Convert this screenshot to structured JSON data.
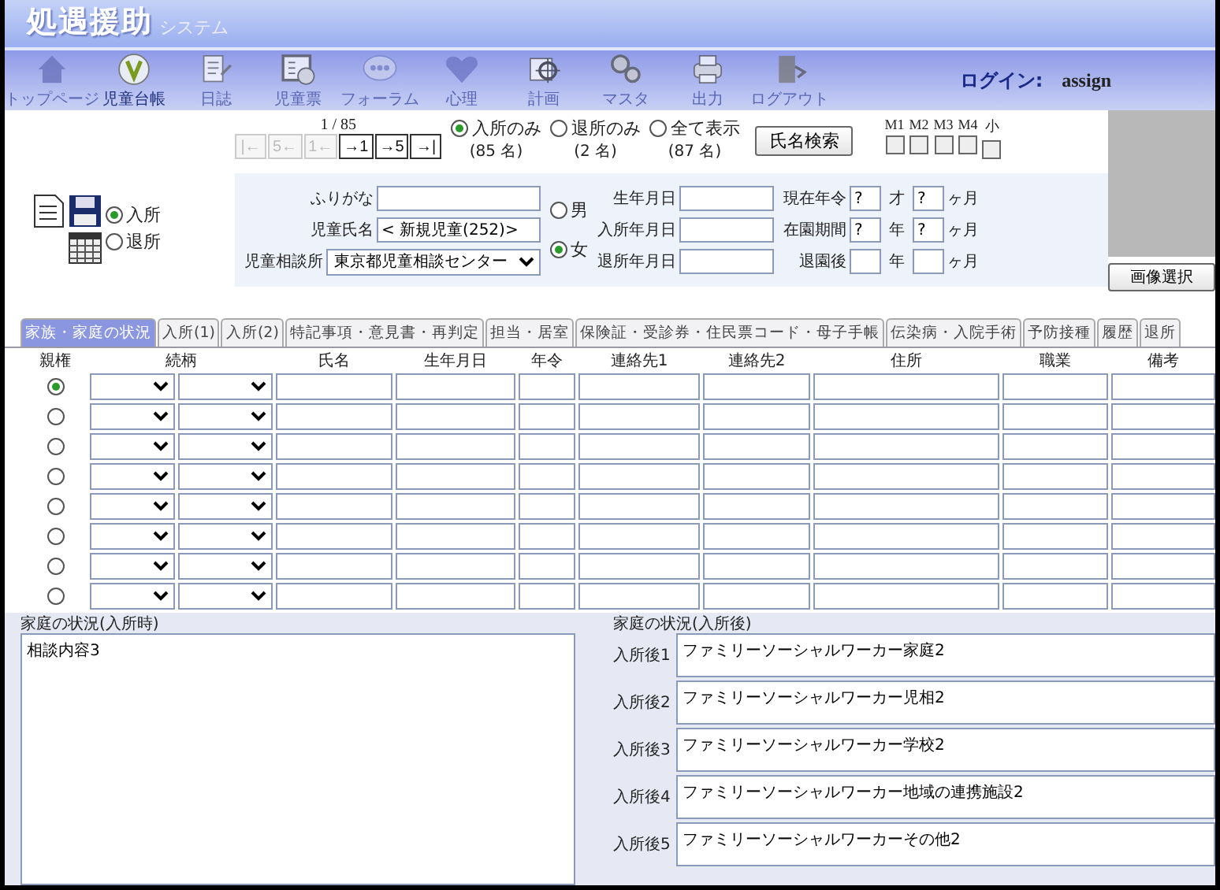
{
  "app": {
    "title": "処遇援助",
    "subtitle": "システム"
  },
  "toolbar": [
    {
      "label": "トップページ",
      "disabled": true
    },
    {
      "label": "児童台帳",
      "disabled": false
    },
    {
      "label": "日誌",
      "disabled": true
    },
    {
      "label": "児童票",
      "disabled": true
    },
    {
      "label": "フォーラム",
      "disabled": true
    },
    {
      "label": "心理",
      "disabled": true
    },
    {
      "label": "計画",
      "disabled": true
    },
    {
      "label": "マスタ",
      "disabled": true
    },
    {
      "label": "出力",
      "disabled": true
    },
    {
      "label": "ログアウト",
      "disabled": true
    }
  ],
  "login": {
    "label": "ログイン:",
    "user": "assign"
  },
  "record_position": "1 / 85",
  "nav_buttons": [
    {
      "label": "|←",
      "disabled": true
    },
    {
      "label": "5←",
      "disabled": true
    },
    {
      "label": "1←",
      "disabled": true
    },
    {
      "label": "→1",
      "disabled": false
    },
    {
      "label": "→5",
      "disabled": false
    },
    {
      "label": "→|",
      "disabled": false
    }
  ],
  "filters": [
    {
      "label": "入所のみ",
      "count": "(85 名)",
      "selected": true
    },
    {
      "label": "退所のみ",
      "count": "(2 名)",
      "selected": false
    },
    {
      "label": "全て表示",
      "count": "(87 名)",
      "selected": false
    }
  ],
  "search_button": "氏名検索",
  "flags": [
    {
      "label": "M1",
      "checked": false
    },
    {
      "label": "M2",
      "checked": false
    },
    {
      "label": "M3",
      "checked": false
    },
    {
      "label": "M4",
      "checked": false
    },
    {
      "label": "小",
      "checked": false
    }
  ],
  "status_options": [
    {
      "label": "入所",
      "selected": true
    },
    {
      "label": "退所",
      "selected": false
    }
  ],
  "form": {
    "furigana": {
      "label": "ふりがな"
    },
    "name": {
      "label": "児童氏名",
      "value": "< 新規児童(252)>"
    },
    "office": {
      "label": "児童相談所",
      "value": "東京都児童相談センター"
    },
    "gender": [
      {
        "label": "男",
        "selected": false
      },
      {
        "label": "女",
        "selected": true
      }
    ],
    "dates": [
      {
        "label": "生年月日"
      },
      {
        "label": "入所年月日"
      },
      {
        "label": "退所年月日"
      }
    ],
    "periods": [
      {
        "label": "現在年令",
        "first": "?",
        "unit1": "才",
        "second": "?",
        "unit2": "ヶ月"
      },
      {
        "label": "在園期間",
        "first": "?",
        "unit1": "年",
        "second": "?",
        "unit2": "ヶ月"
      },
      {
        "label": "退園後",
        "unit1": "年",
        "unit2": "ヶ月"
      }
    ]
  },
  "photo_button": "画像選択",
  "tabs": [
    {
      "label": "家族・家庭の状況",
      "selected": true
    },
    {
      "label": "入所(1)",
      "selected": false
    },
    {
      "label": "入所(2)",
      "selected": false
    },
    {
      "label": "特記事項・意見書・再判定",
      "selected": false
    },
    {
      "label": "担当・居室",
      "selected": false
    },
    {
      "label": "保険証・受診券・住民票コード・母子手帳",
      "selected": false
    },
    {
      "label": "伝染病・入院手術",
      "selected": false
    },
    {
      "label": "予防接種",
      "selected": false
    },
    {
      "label": "履歴",
      "selected": false
    },
    {
      "label": "退所",
      "selected": false
    }
  ],
  "family_table": {
    "columns": [
      "親権",
      "続柄",
      "氏名",
      "生年月日",
      "年令",
      "連絡先1",
      "連絡先2",
      "住所",
      "職業",
      "備考"
    ],
    "rows": [
      {
        "selected": true
      },
      {
        "selected": false
      },
      {
        "selected": false
      },
      {
        "selected": false
      },
      {
        "selected": false
      },
      {
        "selected": false
      },
      {
        "selected": false
      },
      {
        "selected": false
      }
    ]
  },
  "home_before": {
    "label": "家庭の状況(入所時)",
    "value": "相談内容3"
  },
  "home_after": {
    "label": "家庭の状況(入所後)",
    "entries": [
      {
        "label": "入所後1",
        "value": "ファミリーソーシャルワーカー家庭2"
      },
      {
        "label": "入所後2",
        "value": "ファミリーソーシャルワーカー児相2"
      },
      {
        "label": "入所後3",
        "value": "ファミリーソーシャルワーカー学校2"
      },
      {
        "label": "入所後4",
        "value": "ファミリーソーシャルワーカー地域の連携施設2"
      },
      {
        "label": "入所後5",
        "value": "ファミリーソーシャルワーカーその他2"
      }
    ]
  }
}
